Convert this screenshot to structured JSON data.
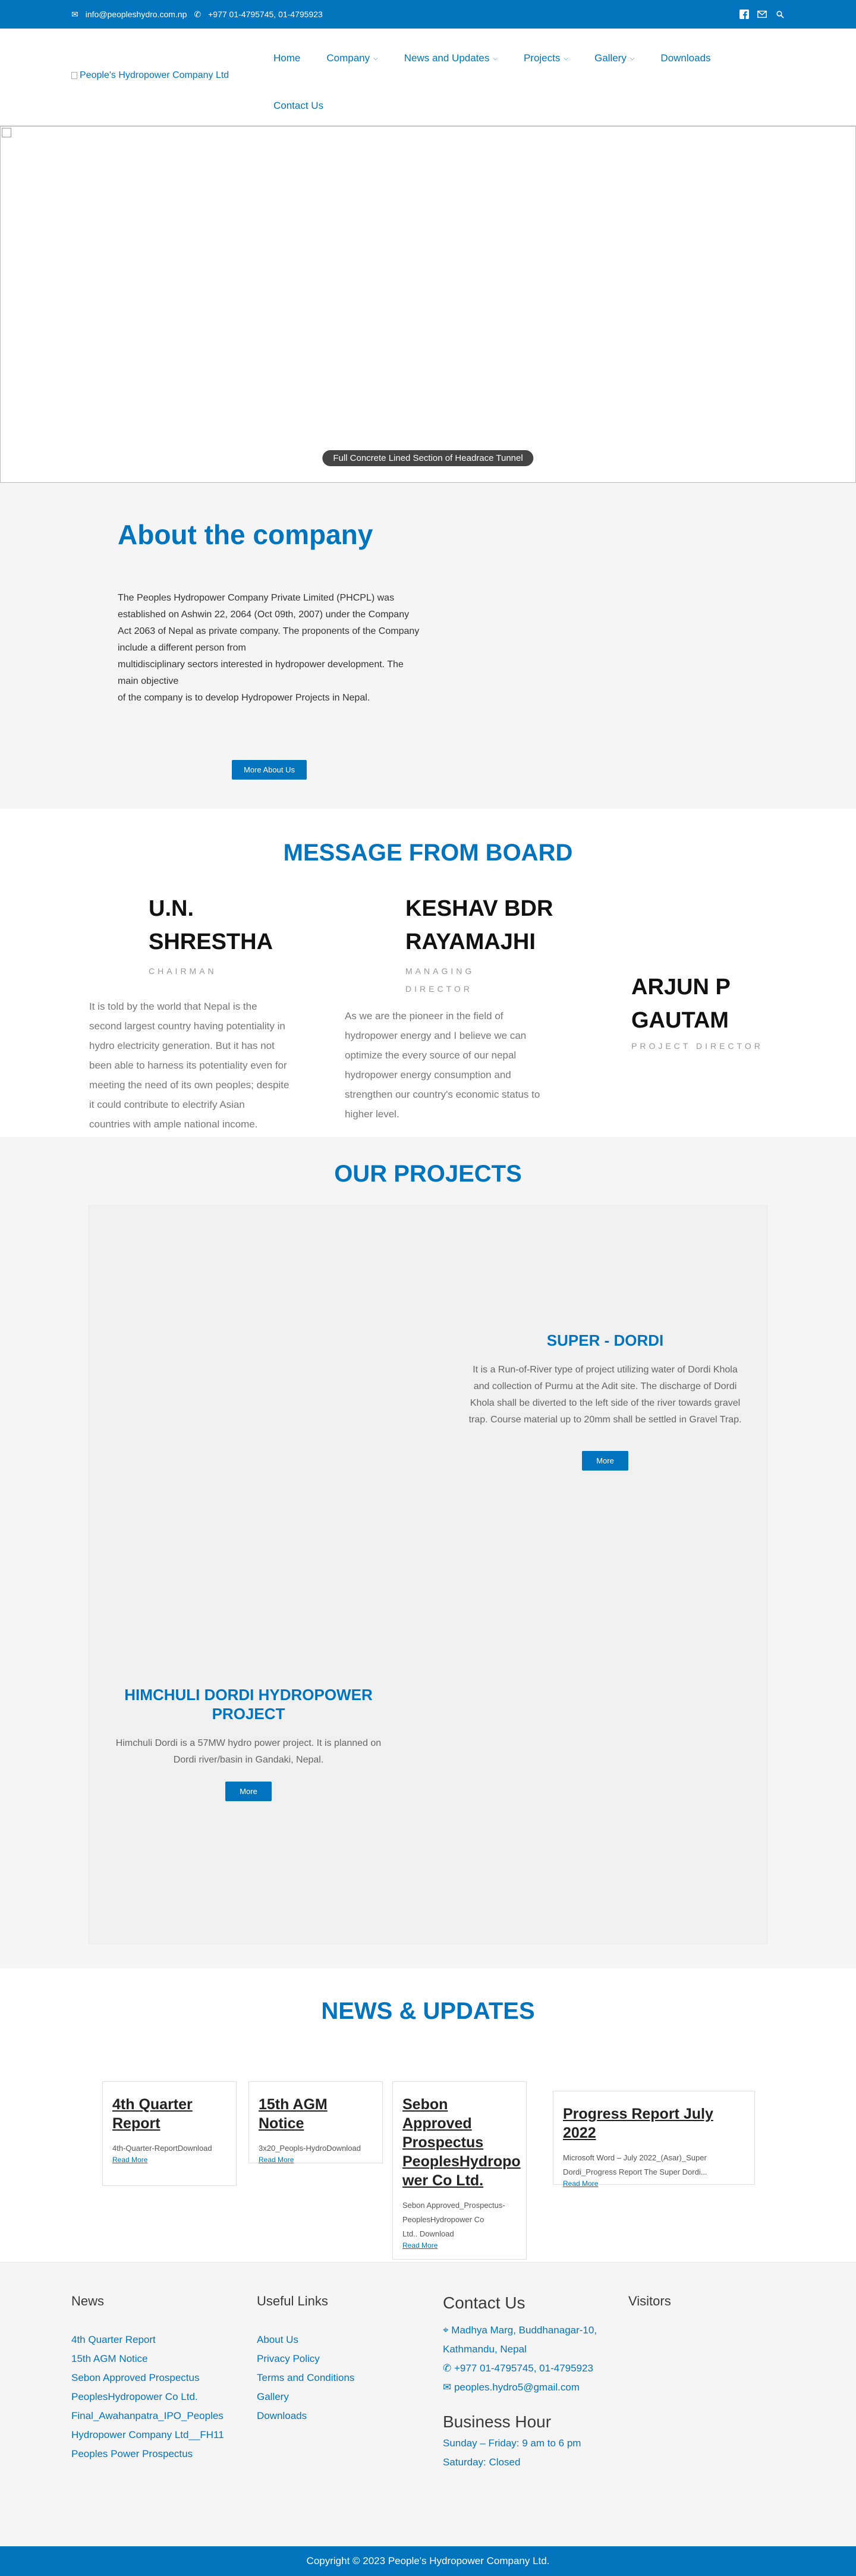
{
  "topbar": {
    "email": "info@peopleshydro.com.np",
    "phone": "+977 01-4795745, 01-4795923"
  },
  "header": {
    "logo_alt": "People's Hydropower Company Ltd",
    "nav": [
      {
        "label": "Home",
        "dropdown": false
      },
      {
        "label": "Company",
        "dropdown": true
      },
      {
        "label": "News and Updates",
        "dropdown": true
      },
      {
        "label": "Projects",
        "dropdown": true
      },
      {
        "label": "Gallery",
        "dropdown": true
      },
      {
        "label": "Downloads",
        "dropdown": false
      }
    ],
    "nav_row2": [
      {
        "label": "Contact Us"
      }
    ]
  },
  "hero": {
    "caption": "Full Concrete Lined Section of Headrace Tunnel"
  },
  "about": {
    "title": "About the company",
    "lines": [
      "The Peoples Hydropower Company Private Limited (PHCPL) was",
      "established on Ashwin 22, 2064 (Oct 09th, 2007) under the Company",
      "Act 2063 of Nepal as private company. The proponents of the Company",
      "include a different person from",
      "multidisciplinary sectors interested in hydropower development. The",
      "main objective",
      "of the company is to develop Hydropower Projects in Nepal."
    ],
    "button": "More About Us"
  },
  "board": {
    "title": "MESSAGE FROM BOARD",
    "members": [
      {
        "name_lines": [
          "U.N.",
          "SHRESTHA"
        ],
        "role": "CHAIRMAN",
        "message_lines": [
          "It is told by the world that Nepal is the",
          "second largest country having potentiality in",
          "hydro electricity generation. But it has not",
          "been able to harness its potentiality even for",
          "meeting the need of its own peoples; despite",
          "it could contribute to electrify Asian",
          "countries with ample national income."
        ]
      },
      {
        "name_lines": [
          "KESHAV BDR",
          "RAYAMAJHI"
        ],
        "role_lines": [
          "MANAGING",
          "DIRECTOR"
        ],
        "message_lines": [
          "As we are the pioneer in the field of",
          "hydropower energy and I believe we can",
          "optimize the every source of our nepal",
          "hydropower energy consumption and",
          "strengthen our country's economic status to",
          "higher level."
        ]
      },
      {
        "name_lines": [
          "ARJUN P",
          "GAUTAM"
        ],
        "role": "PROJECT DIRECTOR"
      }
    ]
  },
  "projects": {
    "title": "OUR PROJECTS",
    "items": [
      {
        "title": "SUPER - DORDI",
        "desc_lines": [
          "It is a Run-of-River type of project utilizing water of Dordi Khola",
          "and collection of Purmu at the Adit site. The discharge of Dordi",
          "Khola shall be diverted to the left side of the river towards gravel",
          "trap. Course material up to 20mm shall be settled in Gravel Trap."
        ],
        "button": "More"
      },
      {
        "title_lines": [
          "HIMCHULI DORDI HYDROPOWER",
          "PROJECT"
        ],
        "desc_lines": [
          "Himchuli Dordi is a 57MW hydro power project. It is planned on",
          "Dordi river/basin in Gandaki, Nepal."
        ],
        "button": "More"
      }
    ]
  },
  "news": {
    "title": "NEWS & UPDATES",
    "cards": [
      {
        "title_lines": [
          "4th Quarter",
          "Report"
        ],
        "desc_lines": [
          "4th-Quarter-ReportDownload"
        ],
        "more": "Read More"
      },
      {
        "title_lines": [
          "15th AGM Notice"
        ],
        "desc_lines": [
          "3x20_Peopls-HydroDownload"
        ],
        "more": "Read More"
      },
      {
        "title_lines": [
          "Sebon Approved",
          "Prospectus",
          "PeoplesHydropo",
          "wer Co Ltd."
        ],
        "desc_lines": [
          "Sebon Approved_Prospectus-",
          "PeoplesHydropower Co",
          "Ltd.. Download"
        ],
        "more": "Read More"
      },
      {
        "title_lines": [
          "Progress Report July 2022"
        ],
        "desc_lines": [
          "Microsoft Word – July 2022_(Asar)_Super",
          "Dordi_Progress Report The Super Dordi..."
        ],
        "more": "Read More"
      }
    ]
  },
  "footer": {
    "news": {
      "title": "News",
      "links": [
        "4th Quarter Report",
        "15th AGM Notice",
        "Sebon Approved Prospectus",
        "PeoplesHydropower Co Ltd.",
        "Final_Awahanpatra_IPO_Peoples",
        "Hydropower Company Ltd__FH11",
        "Peoples Power Prospectus"
      ]
    },
    "useful": {
      "title": "Useful Links",
      "links": [
        "About Us",
        "Privacy Policy",
        "Terms and Conditions",
        "Gallery",
        "Downloads"
      ]
    },
    "contact": {
      "title": "Contact Us",
      "address_lines": [
        "Madhya Marg, Buddhanagar-10,",
        "Kathmandu, Nepal"
      ],
      "phone": "+977 01-4795745, 01-4795923",
      "email": "peoples.hydro5@gmail.com",
      "hours_title": "Business Hour",
      "hours": [
        "Sunday – Friday: 9 am to 6 pm",
        "Saturday: Closed"
      ]
    },
    "visitors": {
      "title": "Visitors"
    },
    "copyright": "Copyright © 2023 People's Hydropower Company Ltd."
  },
  "colors": {
    "brand": "#0274be"
  }
}
